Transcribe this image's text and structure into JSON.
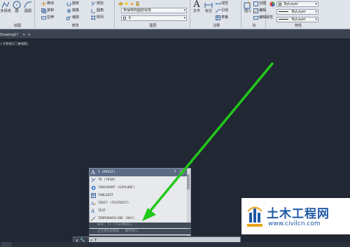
{
  "ribbon": {
    "draw_panel": {
      "title": "绘图",
      "items": [
        "多段线",
        "圆",
        "圆弧"
      ]
    },
    "modify_panel": {
      "title": "修改",
      "rows": [
        [
          "移动",
          "旋转",
          "修剪"
        ],
        [
          "复制",
          "镜像",
          "圆角"
        ],
        [
          "拉伸",
          "缩放",
          "阵列"
        ]
      ]
    },
    "layer_panel": {
      "title": "图层",
      "layer_state": "未保存的图层状态",
      "current_layer": "0"
    },
    "annotation_panel": {
      "title": "注释",
      "text_label": "文字",
      "dim_label": "标注",
      "items": [
        "线性",
        "引线",
        "表格"
      ]
    },
    "block_panel": {
      "title": "块",
      "insert_label": "插入",
      "items": [
        "创建",
        "编辑",
        "编辑属性"
      ]
    },
    "properties_panel": {
      "title": "特性",
      "values": [
        "ByLayer",
        "ByLayer",
        "ByLayer"
      ]
    }
  },
  "doc_tabs": {
    "active": "Drawing1*"
  },
  "viewport_label": "[-][俯视][二维线框]",
  "autocomplete": {
    "items": [
      {
        "icon": "text-icon",
        "label": "T (MTEXT)"
      },
      {
        "icon": "trim-icon",
        "label": "TR (TRIM)"
      },
      {
        "icon": "explode-icon",
        "label": "TAKEAPART (EXPLODE)"
      },
      {
        "icon": "tableedit-icon",
        "label": "TABLEDIT"
      },
      {
        "icon": "textedit-icon",
        "label": "TEDIT (TEXTEDIT)"
      },
      {
        "icon": "text-icon",
        "label": "TEXT"
      },
      {
        "icon": "ray-icon",
        "label": "TEMPORARYLINE (RAY)"
      }
    ]
  },
  "history": [
    "命令: T1 (TILEMODE)",
    "正在重生成模型 - 缓存视口。"
  ],
  "command_line": {
    "value": "T"
  },
  "watermark": {
    "title": "土木工程网",
    "url": "www.civilcn.com"
  },
  "colors": {
    "background": "#212733",
    "arrow": "#22c81a",
    "ribbon": "#dfe3ea",
    "brand": "#1f5aa6"
  }
}
